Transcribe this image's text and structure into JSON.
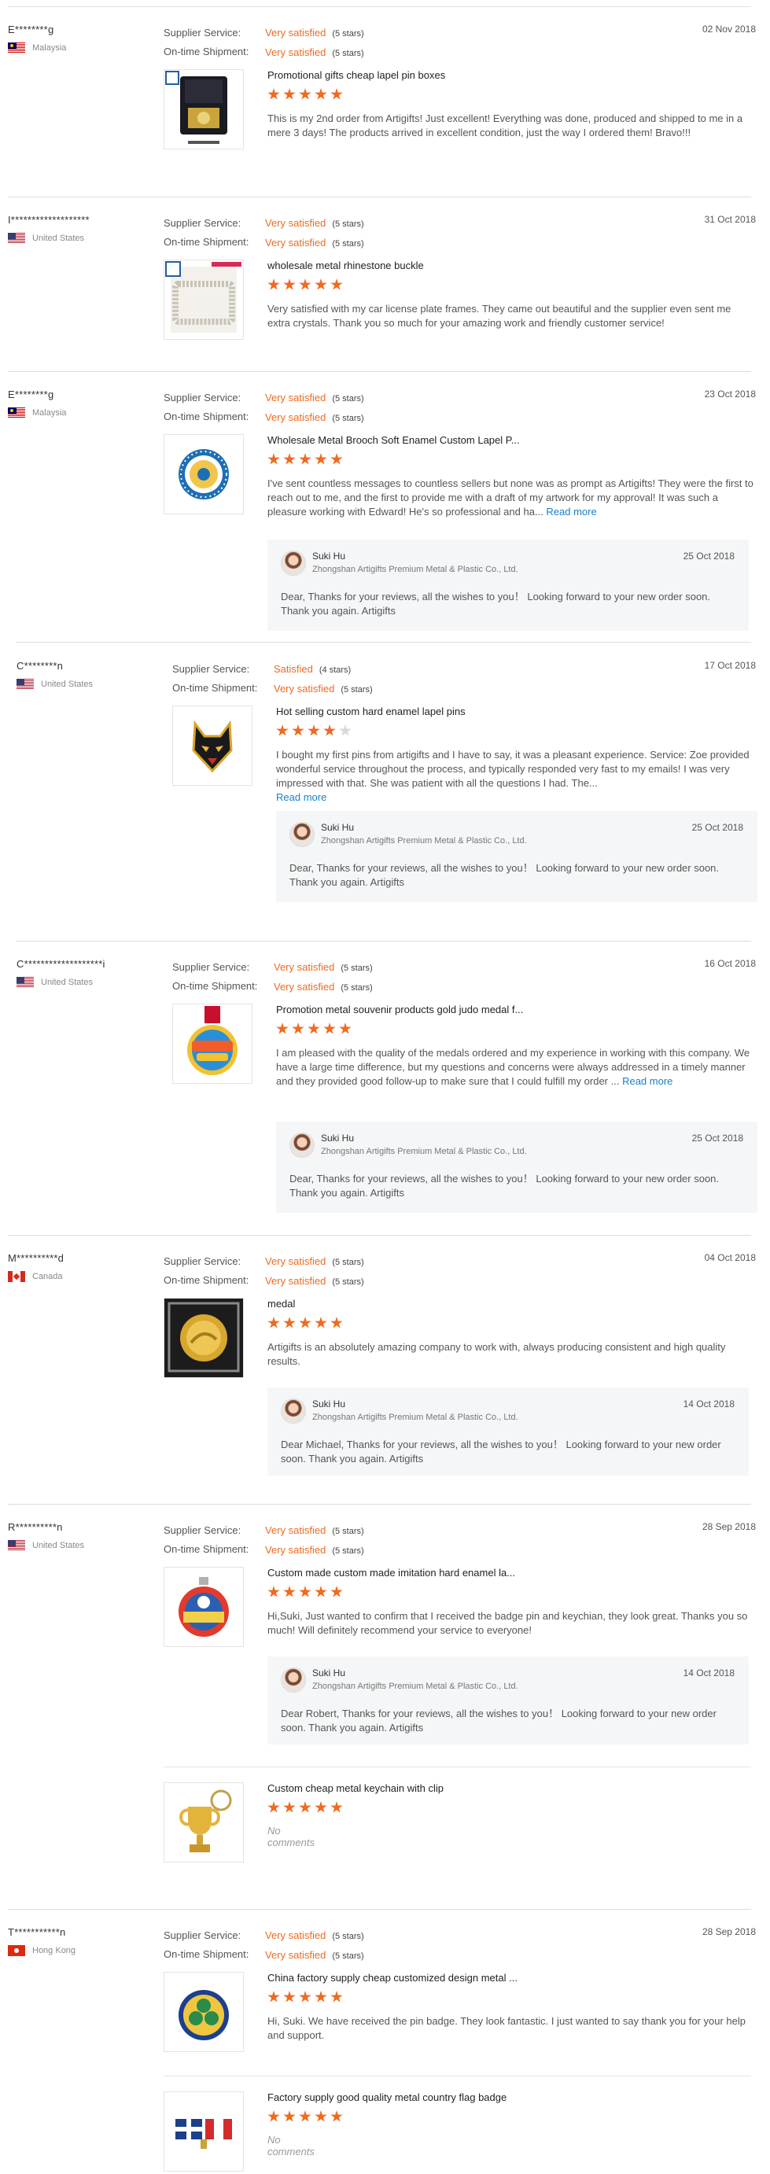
{
  "labels": {
    "supplier_service": "Supplier Service:",
    "ontime_shipment": "On-time Shipment:",
    "read_more": "Read more"
  },
  "colors": {
    "accent": "#f06a1f",
    "link": "#1a80c9"
  },
  "reviews": [
    {
      "buyer": "E********g",
      "country": "Malaysia",
      "flag": "my",
      "date": "02 Nov 2018",
      "service": {
        "text": "Very satisfied",
        "stars": "(5 stars)"
      },
      "shipment": {
        "text": "Very satisfied",
        "stars": "(5 stars)"
      },
      "products": [
        {
          "title": "Promotional gifts cheap lapel pin boxes",
          "rating": 5,
          "icon": "pin-box-image",
          "text": "This is my 2nd order from Artigifts! Just excellent! Everything was done, produced and shipped to me in a mere 3 days! The products arrived in excellent condition, just the way I ordered them! Bravo!!!"
        }
      ]
    },
    {
      "buyer": "I*******************",
      "country": "United States",
      "flag": "us",
      "date": "31 Oct 2018",
      "service": {
        "text": "Very satisfied",
        "stars": "(5 stars)"
      },
      "shipment": {
        "text": "Very satisfied",
        "stars": "(5 stars)"
      },
      "products": [
        {
          "title": "wholesale metal rhinestone buckle",
          "rating": 5,
          "icon": "rhinestone-buckle-image",
          "text": "Very satisfied with my car license plate frames. They came out beautiful and the supplier even sent me extra crystals. Thank you so much for your amazing work and friendly customer service!"
        }
      ]
    },
    {
      "buyer": "E********g",
      "country": "Malaysia",
      "flag": "my",
      "date": "23 Oct 2018",
      "service": {
        "text": "Very satisfied",
        "stars": "(5 stars)"
      },
      "shipment": {
        "text": "Very satisfied",
        "stars": "(5 stars)"
      },
      "products": [
        {
          "title": "Wholesale Metal Brooch Soft Enamel Custom Lapel P...",
          "rating": 5,
          "icon": "enamel-brooch-image",
          "text": "I've sent countless messages to countless sellers but none was as prompt as Artigifts! They were the first to reach out to me, and the first to provide me with a draft of my artwork for my approval! It was such a pleasure working with Edward! He's so professional and ha...",
          "read_more": true
        }
      ],
      "reply": {
        "name": "Suki Hu",
        "company": "Zhongshan Artigifts Premium Metal & Plastic Co., Ltd.",
        "date": "25 Oct 2018",
        "text": "Dear, Thanks for your reviews, all the wishes to you！ Looking forward to your new order soon. Thank you again. Artigifts"
      }
    },
    {
      "buyer": "C********n",
      "country": "United States",
      "flag": "us",
      "date": "17 Oct 2018",
      "service": {
        "text": "Satisfied",
        "stars": "(4 stars)"
      },
      "shipment": {
        "text": "Very satisfied",
        "stars": "(5 stars)"
      },
      "products": [
        {
          "title": "Hot selling custom hard enamel lapel pins",
          "rating": 4,
          "icon": "fox-pin-image",
          "text": "I bought my first pins from artigifts and I have to say, it was a pleasant experience. Service: Zoe provided wonderful service throughout the process, and typically responded very fast to my emails! I was very impressed with that. She was patient with all the questions I had. The...",
          "read_more": true
        }
      ],
      "reply": {
        "name": "Suki Hu",
        "company": "Zhongshan Artigifts Premium Metal & Plastic Co., Ltd.",
        "date": "25 Oct 2018",
        "text": "Dear, Thanks for your reviews, all the wishes to you！ Looking forward to your new order soon. Thank you again. Artigifts"
      }
    },
    {
      "buyer": "C*******************i",
      "country": "United States",
      "flag": "us",
      "date": "16 Oct 2018",
      "service": {
        "text": "Very satisfied",
        "stars": "(5 stars)"
      },
      "shipment": {
        "text": "Very satisfied",
        "stars": "(5 stars)"
      },
      "products": [
        {
          "title": "Promotion metal souvenir products gold judo medal f...",
          "rating": 5,
          "icon": "judo-medal-image",
          "text": "I am pleased with the quality of the medals ordered and my experience in working with this company. We have a large time difference, but my questions and concerns were always addressed in a timely manner and they provided good follow-up to make sure that I could fulfill my order ...",
          "read_more": true
        }
      ],
      "reply": {
        "name": "Suki Hu",
        "company": "Zhongshan Artigifts Premium Metal & Plastic Co., Ltd.",
        "date": "25 Oct 2018",
        "text": "Dear, Thanks for your reviews, all the wishes to you！ Looking forward to your new order soon. Thank you again. Artigifts"
      }
    },
    {
      "buyer": "M**********d",
      "country": "Canada",
      "flag": "ca",
      "date": "04 Oct 2018",
      "service": {
        "text": "Very satisfied",
        "stars": "(5 stars)"
      },
      "shipment": {
        "text": "Very satisfied",
        "stars": "(5 stars)"
      },
      "products": [
        {
          "title": "medal",
          "rating": 5,
          "icon": "gold-medal-image",
          "text": "Artigifts is an absolutely amazing company to work with, always producing consistent and high quality results."
        }
      ],
      "reply": {
        "name": "Suki Hu",
        "company": "Zhongshan Artigifts Premium Metal & Plastic Co., Ltd.",
        "date": "14 Oct 2018",
        "text": "Dear Michael, Thanks for your reviews, all the wishes to you！ Looking forward to your new order soon. Thank you again. Artigifts"
      }
    },
    {
      "buyer": "R**********n",
      "country": "United States",
      "flag": "us",
      "date": "28 Sep 2018",
      "service": {
        "text": "Very satisfied",
        "stars": "(5 stars)"
      },
      "shipment": {
        "text": "Very satisfied",
        "stars": "(5 stars)"
      },
      "products": [
        {
          "title": "Custom made custom made imitation hard enamel la...",
          "rating": 5,
          "icon": "dot-master-pin-image",
          "text": "Hi,Suki, Just wanted to confirm that I received the badge pin and keychian, they look great. Thanks you so much! Will definitely recommend your service to everyone!"
        },
        {
          "title": "Custom cheap metal keychain with clip",
          "rating": 5,
          "icon": "trophy-keychain-image",
          "no_comments": "No comments"
        }
      ],
      "reply": {
        "name": "Suki Hu",
        "company": "Zhongshan Artigifts Premium Metal & Plastic Co., Ltd.",
        "date": "14 Oct 2018",
        "text": "Dear Robert, Thanks for your reviews, all the wishes to you！ Looking forward to your new order soon. Thank you again. Artigifts"
      }
    },
    {
      "buyer": "T***********n",
      "country": "Hong Kong",
      "flag": "hk",
      "date": "28 Sep 2018",
      "service": {
        "text": "Very satisfied",
        "stars": "(5 stars)"
      },
      "shipment": {
        "text": "Very satisfied",
        "stars": "(5 stars)"
      },
      "products": [
        {
          "title": "China factory supply cheap customized design metal ...",
          "rating": 5,
          "icon": "clover-pin-image",
          "text": "Hi, Suki. We have received the pin badge. They look fantastic. I just wanted to say thank you for your help and support."
        },
        {
          "title": "Factory supply good quality metal country flag badge",
          "rating": 5,
          "icon": "flag-badge-image",
          "no_comments": "No comments"
        }
      ]
    }
  ]
}
